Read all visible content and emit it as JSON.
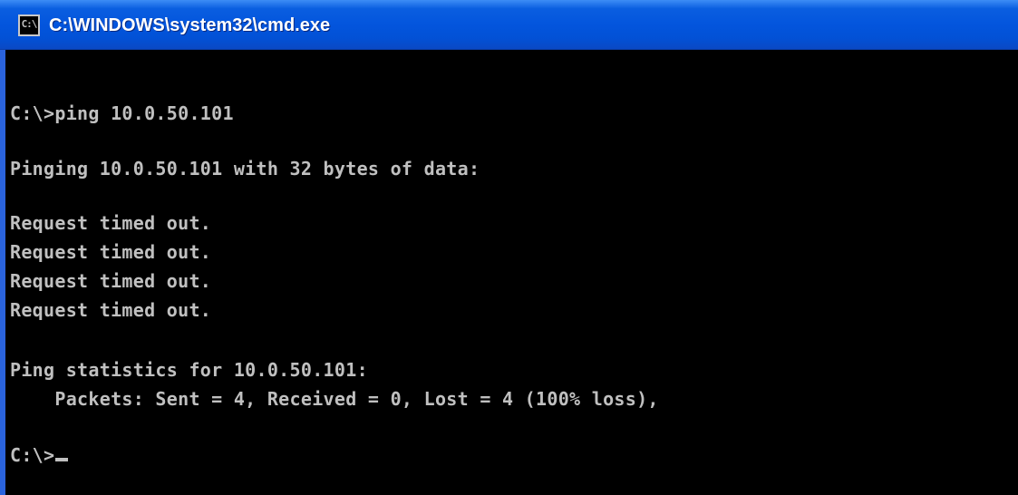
{
  "window": {
    "title": "C:\\WINDOWS\\system32\\cmd.exe",
    "icon": "C:\\"
  },
  "console": {
    "lines": [
      "C:\\>ping 10.0.50.101",
      "Pinging 10.0.50.101 with 32 bytes of data:",
      "Request timed out.",
      "Request timed out.",
      "Request timed out.",
      "Request timed out.",
      "Ping statistics for 10.0.50.101:",
      "    Packets: Sent = 4, Received = 0, Lost = 4 (100% loss),",
      "C:\\>"
    ]
  },
  "colors": {
    "background": "#000000",
    "text": "#c0c0c0",
    "titlebar": "#0355dd"
  },
  "icons": {
    "title_icon": "cmd-icon",
    "cursor": "text-cursor"
  }
}
